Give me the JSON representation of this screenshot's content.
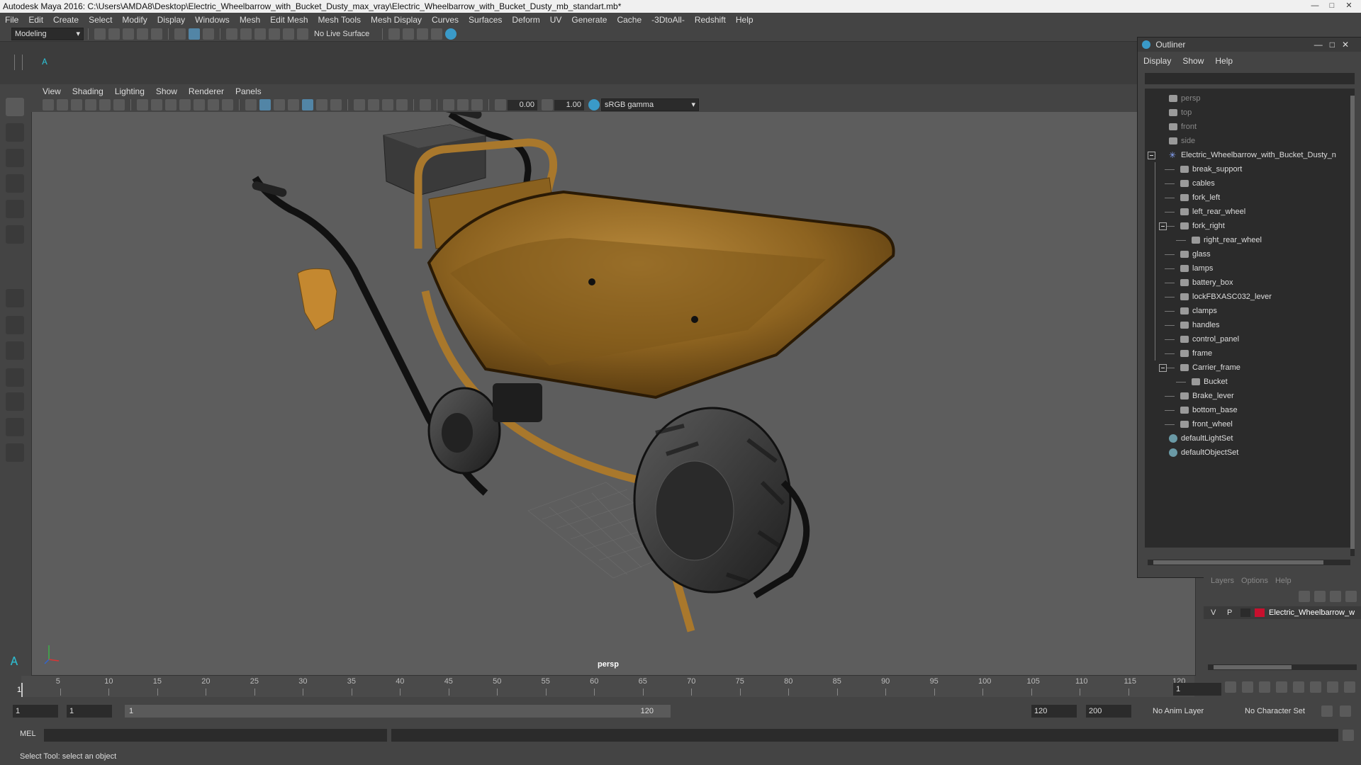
{
  "window": {
    "title": "Autodesk Maya 2016: C:\\Users\\AMDA8\\Desktop\\Electric_Wheelbarrow_with_Bucket_Dusty_max_vray\\Electric_Wheelbarrow_with_Bucket_Dusty_mb_standart.mb*"
  },
  "menubar": [
    "File",
    "Edit",
    "Create",
    "Select",
    "Modify",
    "Display",
    "Windows",
    "Mesh",
    "Edit Mesh",
    "Mesh Tools",
    "Mesh Display",
    "Curves",
    "Surfaces",
    "Deform",
    "UV",
    "Generate",
    "Cache",
    "-3DtoAll-",
    "Redshift",
    "Help"
  ],
  "statusline": {
    "mode": "Modeling",
    "live_surface": "No Live Surface"
  },
  "viewport": {
    "menus": [
      "View",
      "Shading",
      "Lighting",
      "Show",
      "Renderer",
      "Panels"
    ],
    "exposure": "0.00",
    "gamma": "1.00",
    "colorspace": "sRGB gamma",
    "camera_label": "persp"
  },
  "outliner": {
    "title": "Outliner",
    "menus": [
      "Display",
      "Show",
      "Help"
    ],
    "items": [
      {
        "label": "persp",
        "type": "camera",
        "depth": 1,
        "dim": true
      },
      {
        "label": "top",
        "type": "camera",
        "depth": 1,
        "dim": true
      },
      {
        "label": "front",
        "type": "camera",
        "depth": 1,
        "dim": true
      },
      {
        "label": "side",
        "type": "camera",
        "depth": 1,
        "dim": true
      },
      {
        "label": "Electric_Wheelbarrow_with_Bucket_Dusty_n",
        "type": "group",
        "depth": 1,
        "expanded": true
      },
      {
        "label": "break_support",
        "type": "mesh",
        "depth": 2
      },
      {
        "label": "cables",
        "type": "mesh",
        "depth": 2
      },
      {
        "label": "fork_left",
        "type": "mesh",
        "depth": 2
      },
      {
        "label": "left_rear_wheel",
        "type": "mesh",
        "depth": 2
      },
      {
        "label": "fork_right",
        "type": "mesh",
        "depth": 2,
        "expanded": true
      },
      {
        "label": "right_rear_wheel",
        "type": "mesh",
        "depth": 3
      },
      {
        "label": "glass",
        "type": "mesh",
        "depth": 2
      },
      {
        "label": "lamps",
        "type": "mesh",
        "depth": 2
      },
      {
        "label": "battery_box",
        "type": "mesh",
        "depth": 2
      },
      {
        "label": "lockFBXASC032_lever",
        "type": "mesh",
        "depth": 2
      },
      {
        "label": "clamps",
        "type": "mesh",
        "depth": 2
      },
      {
        "label": "handles",
        "type": "mesh",
        "depth": 2
      },
      {
        "label": "control_panel",
        "type": "mesh",
        "depth": 2
      },
      {
        "label": "frame",
        "type": "mesh",
        "depth": 2
      },
      {
        "label": "Carrier_frame",
        "type": "mesh",
        "depth": 2,
        "expanded": true
      },
      {
        "label": "Bucket",
        "type": "mesh",
        "depth": 3
      },
      {
        "label": "Brake_lever",
        "type": "mesh",
        "depth": 2
      },
      {
        "label": "bottom_base",
        "type": "mesh",
        "depth": 2
      },
      {
        "label": "front_wheel",
        "type": "mesh",
        "depth": 2
      },
      {
        "label": "defaultLightSet",
        "type": "set",
        "depth": 1
      },
      {
        "label": "defaultObjectSet",
        "type": "set",
        "depth": 1
      }
    ]
  },
  "layers": {
    "menus": [
      "Layers",
      "Options",
      "Help"
    ],
    "row": {
      "v": "V",
      "p": "P",
      "name": "Electric_Wheelbarrow_w",
      "color": "#c8102e"
    }
  },
  "timeline": {
    "ticks": [
      "5",
      "10",
      "15",
      "20",
      "25",
      "30",
      "35",
      "40",
      "45",
      "50",
      "55",
      "60",
      "65",
      "70",
      "75",
      "80",
      "85",
      "90",
      "95",
      "100",
      "105",
      "110",
      "115",
      "120"
    ],
    "current_frame": "1",
    "start_marker": "1"
  },
  "range": {
    "start": "1",
    "playback_start": "1",
    "slider_start": "1",
    "slider_end": "120",
    "playback_end": "120",
    "end": "200",
    "anim_layer": "No Anim Layer",
    "character_set": "No Character Set"
  },
  "command": {
    "label": "MEL"
  },
  "help": {
    "text": "Select Tool: select an object"
  },
  "colors": {
    "bucket": "#9a6b1f",
    "frame": "#a9782c",
    "viewport_bg": "#5d5d5d"
  }
}
